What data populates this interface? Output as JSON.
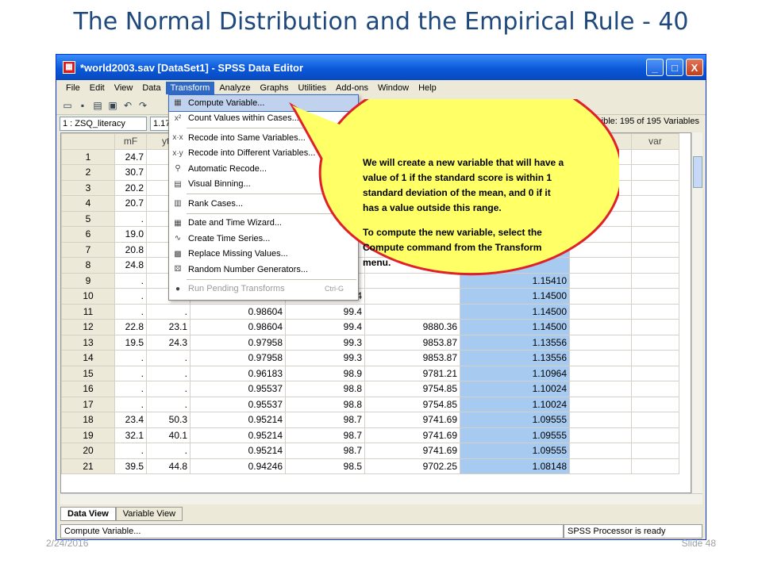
{
  "slide": {
    "title": "The Normal Distribution and the Empirical Rule - 40",
    "date": "2/24/2016",
    "number": "Slide 48"
  },
  "window": {
    "title": "*world2003.sav [DataSet1] - SPSS Data Editor",
    "buttons": [
      "_",
      "□",
      "X"
    ]
  },
  "menubar": [
    "File",
    "Edit",
    "View",
    "Data",
    "Transform",
    "Analyze",
    "Graphs",
    "Utilities",
    "Add-ons",
    "Window",
    "Help"
  ],
  "cellbar": {
    "ref": "1 : ZSQ_literacy",
    "value": "1.17",
    "visible": "Visible: 195 of 195 Variables"
  },
  "grid": {
    "headers": [
      "",
      "mF",
      "yth",
      "",
      "",
      "",
      "acy",
      "var",
      "var"
    ],
    "rows": [
      [
        "1",
        "24.7",
        "",
        "",
        "",
        "",
        "1.17205",
        "",
        ""
      ],
      [
        "2",
        "30.7",
        "",
        "",
        "",
        "",
        "",
        "",
        ""
      ],
      [
        "3",
        "20.2",
        "",
        "",
        "",
        "",
        "",
        "",
        ""
      ],
      [
        "4",
        "20.7",
        "",
        "",
        "",
        "",
        "",
        "",
        ""
      ],
      [
        "5",
        ".",
        "",
        "",
        "",
        "",
        "",
        "",
        ""
      ],
      [
        "6",
        "19.0",
        "",
        "",
        "",
        "",
        "",
        "",
        ""
      ],
      [
        "7",
        "20.8",
        "",
        "",
        "",
        "",
        "",
        "",
        ""
      ],
      [
        "8",
        "24.8",
        "",
        "",
        "",
        "",
        "",
        "",
        ""
      ],
      [
        "9",
        ".",
        "",
        "",
        "",
        "",
        "1.15410",
        "",
        ""
      ],
      [
        "10",
        ".",
        ".",
        "0.98604",
        "99.4",
        "",
        "1.14500",
        "",
        ""
      ],
      [
        "11",
        ".",
        ".",
        "0.98604",
        "99.4",
        "",
        "1.14500",
        "",
        ""
      ],
      [
        "12",
        "22.8",
        "23.1",
        "0.98604",
        "99.4",
        "9880.36",
        "1.14500",
        "",
        ""
      ],
      [
        "13",
        "19.5",
        "24.3",
        "0.97958",
        "99.3",
        "9853.87",
        "1.13556",
        "",
        ""
      ],
      [
        "14",
        ".",
        ".",
        "0.97958",
        "99.3",
        "9853.87",
        "1.13556",
        "",
        ""
      ],
      [
        "15",
        ".",
        ".",
        "0.96183",
        "98.9",
        "9781.21",
        "1.10964",
        "",
        ""
      ],
      [
        "16",
        ".",
        ".",
        "0.95537",
        "98.8",
        "9754.85",
        "1.10024",
        "",
        ""
      ],
      [
        "17",
        ".",
        ".",
        "0.95537",
        "98.8",
        "9754.85",
        "1.10024",
        "",
        ""
      ],
      [
        "18",
        "23.4",
        "50.3",
        "0.95214",
        "98.7",
        "9741.69",
        "1.09555",
        "",
        ""
      ],
      [
        "19",
        "32.1",
        "40.1",
        "0.95214",
        "98.7",
        "9741.69",
        "1.09555",
        "",
        ""
      ],
      [
        "20",
        ".",
        ".",
        "0.95214",
        "98.7",
        "9741.69",
        "1.09555",
        "",
        ""
      ],
      [
        "21",
        "39.5",
        "44.8",
        "0.94246",
        "98.5",
        "9702.25",
        "1.08148",
        "",
        ""
      ]
    ]
  },
  "menu": {
    "items": [
      {
        "icon": "▦",
        "label": "Compute Variable...",
        "highlight": true
      },
      {
        "icon": "x²",
        "label": "Count Values within Cases..."
      },
      {
        "sep": true
      },
      {
        "icon": "x·x",
        "label": "Recode into Same Variables..."
      },
      {
        "icon": "x·y",
        "label": "Recode into Different Variables..."
      },
      {
        "icon": "⚲",
        "label": "Automatic Recode..."
      },
      {
        "icon": "▤",
        "label": "Visual Binning..."
      },
      {
        "sep": true
      },
      {
        "icon": "▥",
        "label": "Rank Cases..."
      },
      {
        "sep": true
      },
      {
        "icon": "▦",
        "label": "Date and Time Wizard..."
      },
      {
        "icon": "∿",
        "label": "Create Time Series..."
      },
      {
        "icon": "▩",
        "label": "Replace Missing Values..."
      },
      {
        "icon": "⚄",
        "label": "Random Number Generators..."
      },
      {
        "sep": true
      },
      {
        "icon": "●",
        "label": "Run Pending Transforms",
        "disabled": true,
        "shortcut": "Ctrl-G"
      }
    ]
  },
  "bubble": {
    "p1": "We will create a new variable that will have a value of 1 if the standard score is within 1 standard deviation of the mean, and 0 if it has a value outside this range.",
    "p2": "To compute the new variable, select the Compute command from the Transform menu."
  },
  "tabs": [
    "Data View",
    "Variable View"
  ],
  "status": {
    "left": "Compute Variable...",
    "right": "SPSS  Processor is ready"
  },
  "colors": {
    "accent": "#316ac5",
    "selected_column": "#a6caf0",
    "bubble_fill": "#ffff66",
    "bubble_border": "#e0202a"
  }
}
